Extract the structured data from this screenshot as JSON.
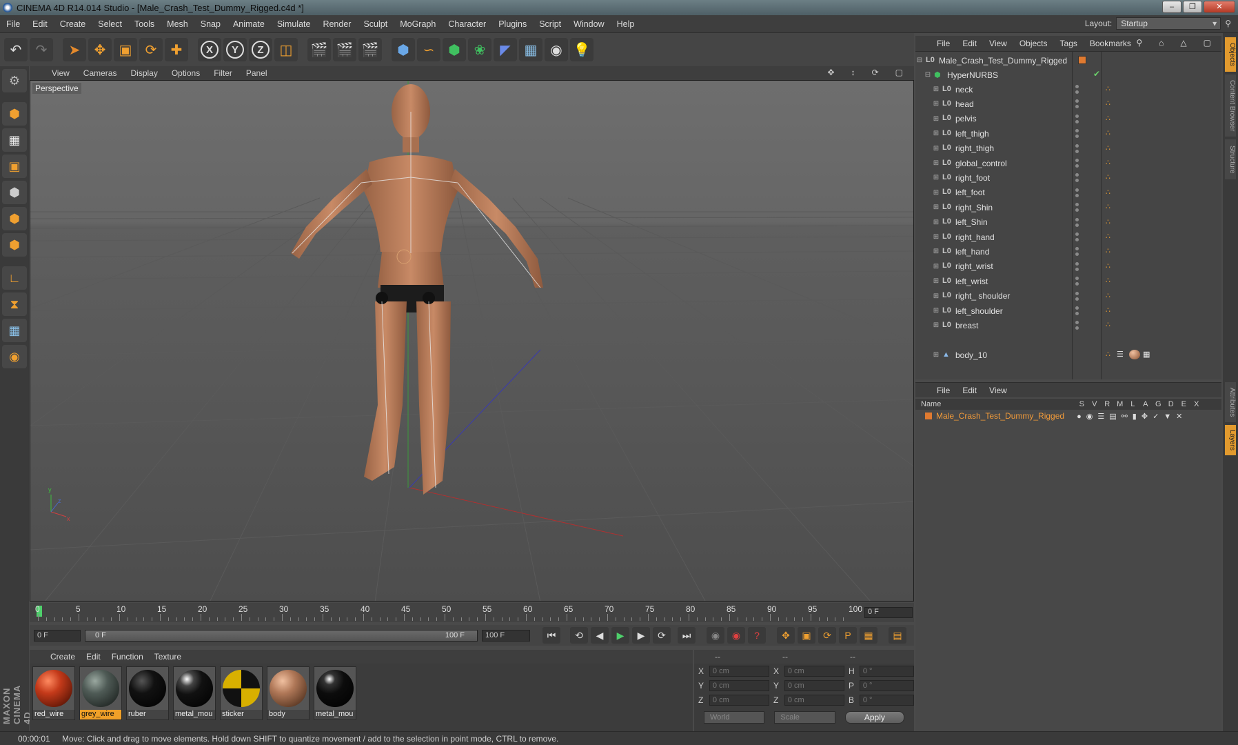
{
  "window": {
    "title": "CINEMA 4D R14.014 Studio - [Male_Crash_Test_Dummy_Rigged.c4d *]",
    "controls": [
      "‒",
      "❐",
      "✕"
    ]
  },
  "menubar": {
    "items": [
      "File",
      "Edit",
      "Create",
      "Select",
      "Tools",
      "Mesh",
      "Snap",
      "Animate",
      "Simulate",
      "Render",
      "Sculpt",
      "MoGraph",
      "Character",
      "Plugins",
      "Script",
      "Window",
      "Help"
    ],
    "layout_label": "Layout:",
    "layout_value": "Startup"
  },
  "toolbar": {
    "axis_x": "X",
    "axis_y": "Y",
    "axis_z": "Z"
  },
  "viewport": {
    "menu": [
      "View",
      "Cameras",
      "Display",
      "Options",
      "Filter",
      "Panel"
    ],
    "label": "Perspective",
    "axis_labels": {
      "x": "x",
      "y": "y",
      "z": "z"
    }
  },
  "timeline": {
    "marks": [
      "0",
      "5",
      "10",
      "15",
      "20",
      "25",
      "30",
      "35",
      "40",
      "45",
      "50",
      "55",
      "60",
      "65",
      "70",
      "75",
      "80",
      "85",
      "90",
      "95",
      "100"
    ],
    "current_frame": "0 F"
  },
  "transport": {
    "start_frame": "0 F",
    "range_start": "0 F",
    "range_end": "100 F",
    "end_frame": "100 F"
  },
  "materials": {
    "menu": [
      "Create",
      "Edit",
      "Function",
      "Texture"
    ],
    "items": [
      {
        "name": "red_wire",
        "color": "#c43a1a"
      },
      {
        "name": "grey_wire",
        "color": "#4f5b56",
        "selected": true
      },
      {
        "name": "ruber",
        "color": "#111111"
      },
      {
        "name": "metal_mou",
        "color": "#1a1a1a"
      },
      {
        "name": "sticker",
        "color": "#d8b000"
      },
      {
        "name": "body",
        "color": "#b07858"
      },
      {
        "name": "metal_mou",
        "color": "#0c0c0c"
      }
    ]
  },
  "coordinates": {
    "header": [
      "--",
      "--",
      "--"
    ],
    "rows": [
      {
        "a": "X",
        "av": "0 cm",
        "b": "X",
        "bv": "0 cm",
        "c": "H",
        "cv": "0 °"
      },
      {
        "a": "Y",
        "av": "0 cm",
        "b": "Y",
        "bv": "0 cm",
        "c": "P",
        "cv": "0 °"
      },
      {
        "a": "Z",
        "av": "0 cm",
        "b": "Z",
        "bv": "0 cm",
        "c": "B",
        "cv": "0 °"
      }
    ],
    "space": "World",
    "mode": "Scale",
    "apply_label": "Apply"
  },
  "object_manager": {
    "menu": [
      "File",
      "Edit",
      "View",
      "Objects",
      "Tags",
      "Bookmarks"
    ],
    "root": "Male_Crash_Test_Dummy_Rigged",
    "nurbs": "HyperNURBS",
    "joints": [
      "neck",
      "head",
      "pelvis",
      "left_thigh",
      "right_thigh",
      "global_control",
      "right_foot",
      "left_foot",
      "right_Shin",
      "left_Shin",
      "right_hand",
      "left_hand",
      "right_wrist",
      "left_wrist",
      "right_ shoulder",
      "left_shoulder",
      "breast"
    ],
    "mesh": "body_10"
  },
  "layer_manager": {
    "menu": [
      "File",
      "Edit",
      "View"
    ],
    "columns": [
      "Name",
      "S",
      "V",
      "R",
      "M",
      "L",
      "A",
      "G",
      "D",
      "E",
      "X"
    ],
    "layer": "Male_Crash_Test_Dummy_Rigged"
  },
  "right_tabs": [
    "Objects",
    "Content Browser",
    "Structure",
    "Attributes",
    "Layers"
  ],
  "status": {
    "time": "00:00:01",
    "message": "Move: Click and drag to move elements. Hold down SHIFT to quantize movement / add to the selection in point mode, CTRL to remove."
  },
  "logo": "MAXON CINEMA 4D"
}
